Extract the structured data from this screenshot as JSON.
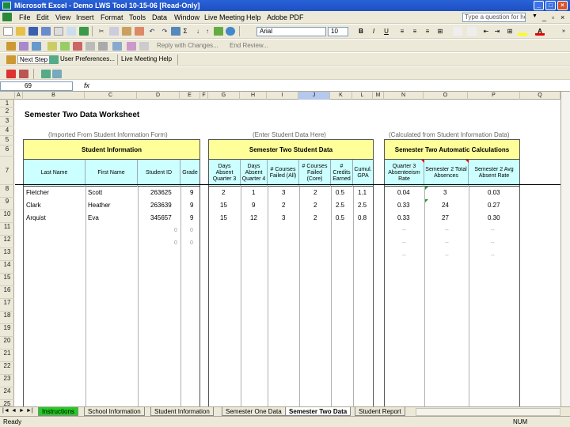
{
  "window": {
    "title": "Microsoft Excel - Demo LWS Tool 10-15-06  [Read-Only]",
    "min": "_",
    "max": "□",
    "close": "×"
  },
  "menu": {
    "items": [
      "File",
      "Edit",
      "View",
      "Insert",
      "Format",
      "Tools",
      "Data",
      "Window",
      "Live Meeting",
      "Help",
      "Adobe PDF"
    ],
    "help_placeholder": "Type a question for help",
    "doc_close": "×"
  },
  "toolbar": {
    "font_name": "Arial",
    "font_size": "10",
    "bold": "B",
    "italic": "I",
    "underline": "U",
    "sigma": "Σ",
    "reply_label": "Reply with Changes...",
    "end_review_label": "End Review...",
    "toolbar3_items": [
      "Next Step",
      "User Preferences...",
      "Live Meeting Help"
    ]
  },
  "formula": {
    "name_box": "69",
    "fx": "fx",
    "value": ""
  },
  "columns": [
    "A",
    "B",
    "C",
    "D",
    "E",
    "F",
    "G",
    "H",
    "I",
    "J",
    "K",
    "L",
    "M",
    "N",
    "O",
    "P",
    "Q"
  ],
  "rows": [
    "1",
    "2",
    "3",
    "4",
    "5",
    "6",
    "7",
    "8",
    "9",
    "10",
    "11",
    "12",
    "13",
    "14",
    "15",
    "16",
    "17",
    "18",
    "19",
    "20",
    "21",
    "22",
    "23",
    "24",
    "25"
  ],
  "sheet": {
    "title": "Semester Two Data Worksheet",
    "notes": {
      "left": "(Imported From Student Information Form)",
      "middle": "(Enter Student Data Here)",
      "right": "(Calculated from Student Information Data)"
    },
    "sections": {
      "student_info": {
        "header": "Student Information",
        "columns": [
          "Last Name",
          "First Name",
          "Student ID",
          "Grade"
        ],
        "rows": [
          [
            "Fletcher",
            "Scott",
            "263625",
            "9"
          ],
          [
            "Clark",
            "Heather",
            "263639",
            "9"
          ],
          [
            "Arquist",
            "Eva",
            "345657",
            "9"
          ]
        ],
        "empty_markers": [
          "0",
          "0"
        ]
      },
      "student_data": {
        "header": "Semester Two Student Data",
        "columns": [
          "Days Absent Quarter 3",
          "Days Absent Quarter 4",
          "# Courses Failed (All)",
          "# Courses Failed (Core)",
          "# Credits Earned",
          "Cumul. GPA"
        ],
        "rows": [
          [
            "2",
            "1",
            "3",
            "2",
            "0.5",
            "1.1"
          ],
          [
            "15",
            "9",
            "2",
            "2",
            "2.5",
            "2.5"
          ],
          [
            "15",
            "12",
            "3",
            "2",
            "0.5",
            "0.8"
          ]
        ]
      },
      "auto_calc": {
        "header": "Semester Two Automatic Calculations",
        "columns": [
          "Quarter 3 Absenteeism Rate",
          "Semester 2 Total Absences",
          "Semester 2 Avg Absent Rate"
        ],
        "rows": [
          [
            "0.04",
            "3",
            "0.03"
          ],
          [
            "0.33",
            "24",
            "0.27"
          ],
          [
            "0.33",
            "27",
            "0.30"
          ]
        ],
        "empty_marker": "--"
      }
    }
  },
  "tabs": {
    "items": [
      "Instructions",
      "School Information",
      "Student Information",
      "Semester One Data",
      "Semester Two Data",
      "Student Report"
    ],
    "active": "Semester Two Data",
    "nav": [
      "|◄",
      "◄",
      "►",
      "►|"
    ]
  },
  "status": {
    "left": "Ready",
    "right": "NUM"
  },
  "colors": {
    "title_blue": "#1d4fc4",
    "header_yellow": "#ffff99",
    "colhead_cyan": "#ccffff",
    "tab_green": "#22cc22"
  }
}
